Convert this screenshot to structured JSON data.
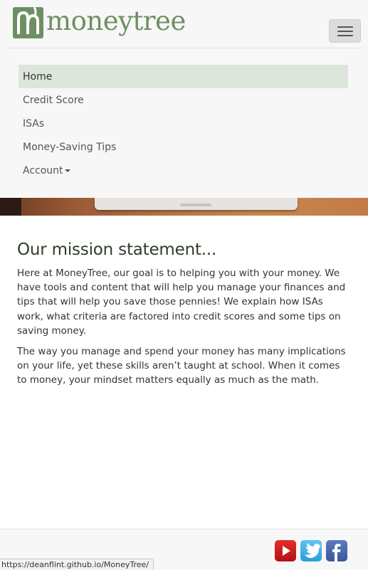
{
  "brand": {
    "name": "moneytree"
  },
  "nav": {
    "toggle_icon": "hamburger-icon",
    "items": [
      {
        "label": "Home",
        "active": true
      },
      {
        "label": "Credit Score",
        "active": false
      },
      {
        "label": "ISAs",
        "active": false
      },
      {
        "label": "Money-Saving Tips",
        "active": false
      },
      {
        "label": "Account",
        "active": false,
        "dropdown": true
      }
    ]
  },
  "main": {
    "title": "Our mission statement...",
    "paragraphs": [
      "Here at MoneyTree, our goal is to helping you with your money. We have tools and content that will help you manage your finances and tips that will help you save those pennies! We explain how ISAs work, what criteria are factored into credit scores and some tips on saving money.",
      "The way you manage and spend your money has many implications on your life, yet these skills aren’t taught at school. When it comes to money, your mindset matters equally as much as the math."
    ]
  },
  "footer": {
    "social": [
      "youtube-icon",
      "twitter-icon",
      "facebook-icon"
    ]
  },
  "status_bar": {
    "url": "https://deanflint.github.io/MoneyTree/"
  },
  "colors": {
    "brand_green": "#6e8f63",
    "active_nav_bg": "#dde6da",
    "header_bg": "#f7f7f7"
  }
}
